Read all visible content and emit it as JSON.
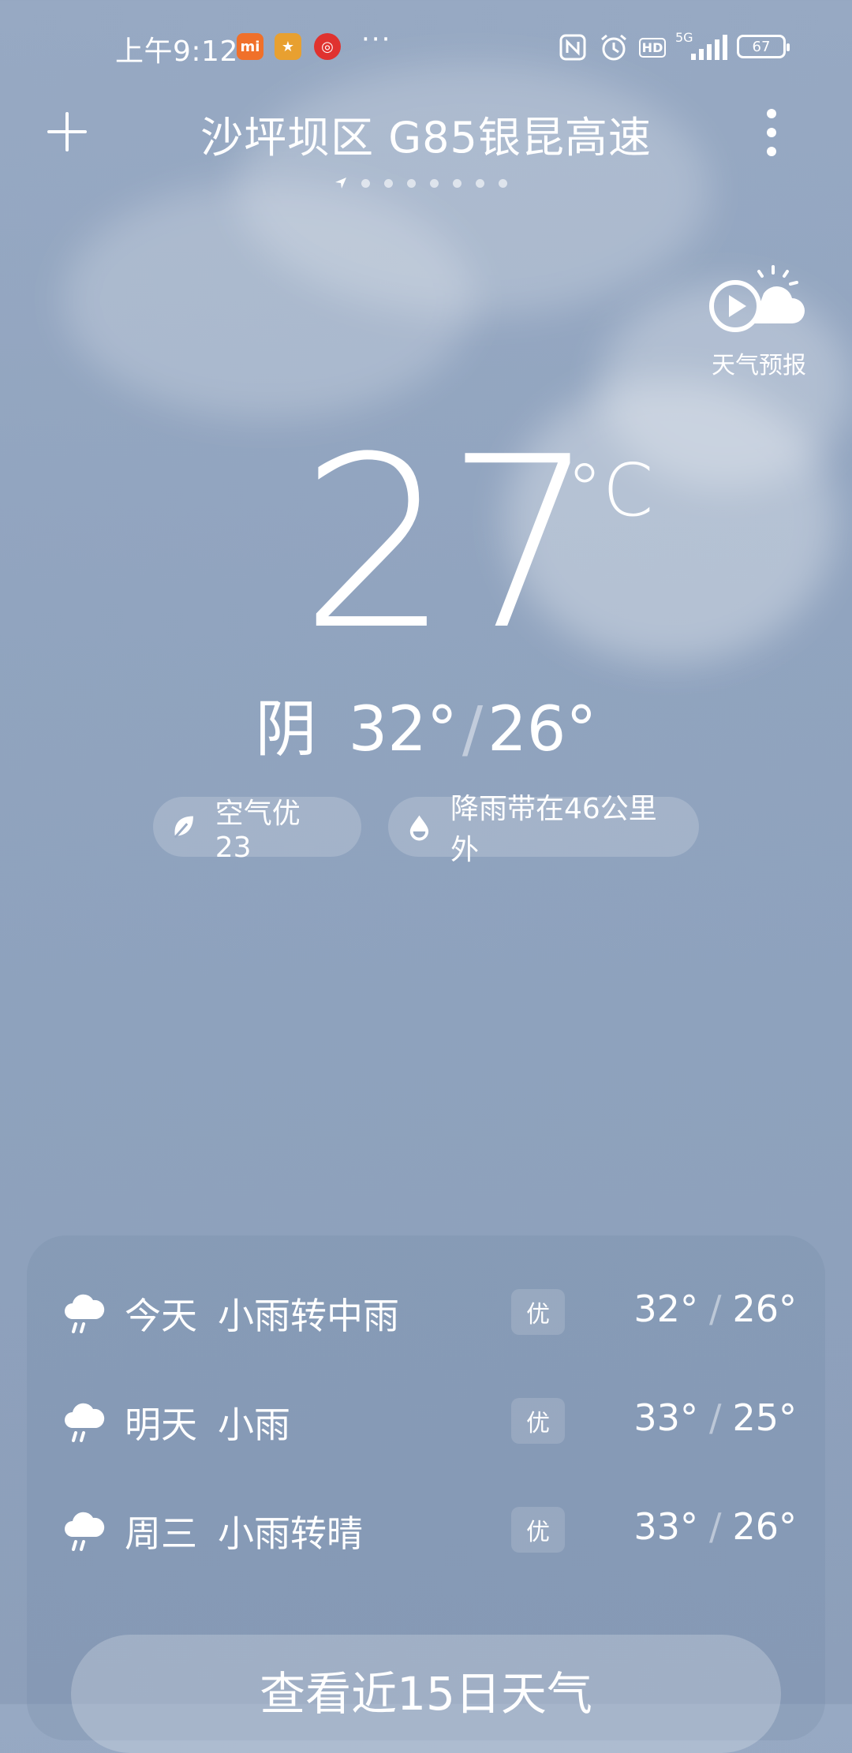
{
  "status_bar": {
    "time": "上午9:12",
    "more": "···",
    "network": "5G",
    "hd": "HD",
    "battery": "67"
  },
  "header": {
    "location": "沙坪坝区 G85银昆高速",
    "page_count": 7
  },
  "video_forecast": {
    "label": "天气预报"
  },
  "current": {
    "temperature": "27",
    "unit": "°C",
    "condition": "阴",
    "high": "32°",
    "low": "26°",
    "slash": "/"
  },
  "chips": {
    "air_quality": "空气优 23",
    "rain_band": "降雨带在46公里外"
  },
  "forecast": [
    {
      "day": "今天",
      "desc": "小雨转中雨",
      "aqi": "优",
      "high": "32°",
      "low": "26°"
    },
    {
      "day": "明天",
      "desc": "小雨",
      "aqi": "优",
      "high": "33°",
      "low": "25°"
    },
    {
      "day": "周三",
      "desc": "小雨转晴",
      "aqi": "优",
      "high": "33°",
      "low": "26°"
    }
  ],
  "forecast_slash": "/",
  "view15_label": "查看近15日天气",
  "icons": {
    "add": "plus-icon",
    "more": "more-vertical-icon",
    "location": "location-arrow-icon",
    "video": "video-forecast-icon",
    "leaf": "leaf-icon",
    "drop": "raindrop-icon",
    "rain": "rain-cloud-icon"
  }
}
